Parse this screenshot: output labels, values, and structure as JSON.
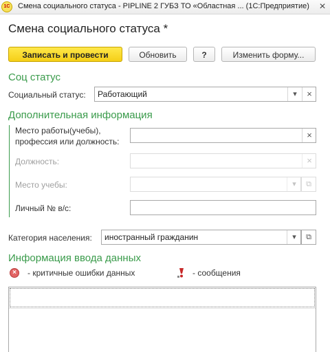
{
  "window": {
    "title": "Смена социального статуса - PIPLINE 2 ГУБЗ ТО «Областная ...  (1С:Предприятие)",
    "app_icon": "1С",
    "close_glyph": "×"
  },
  "form": {
    "title": "Смена социального статуса *"
  },
  "toolbar": {
    "post_label": "Записать и провести",
    "refresh_label": "Обновить",
    "help_label": "?",
    "change_form_label": "Изменить форму..."
  },
  "soc_status": {
    "heading": "Соц статус",
    "label": "Социальный статус:",
    "value": "Работающий"
  },
  "additional": {
    "heading": "Дополнительная информация",
    "workplace_label_1": "Место работы(учебы),",
    "workplace_label_2": "профессия или должность:",
    "workplace_value": "",
    "position_label": "Должность:",
    "position_value": "",
    "study_label": "Место учебы:",
    "study_value": "",
    "idnum_label": "Личный № в/с:",
    "idnum_value": ""
  },
  "population": {
    "label": "Категория населения:",
    "value": "иностранный гражданин"
  },
  "data_entry": {
    "heading": "Информация ввода данных",
    "critical_legend": "- критичные ошибки данных",
    "messages_legend": "- сообщения"
  },
  "icons": {
    "dropdown": "▾",
    "clear": "×",
    "open": "⧉",
    "error": "×"
  },
  "colors": {
    "section_green": "#3a9b4b",
    "primary_button": "#f5cf17",
    "error_red": "#e26464"
  }
}
